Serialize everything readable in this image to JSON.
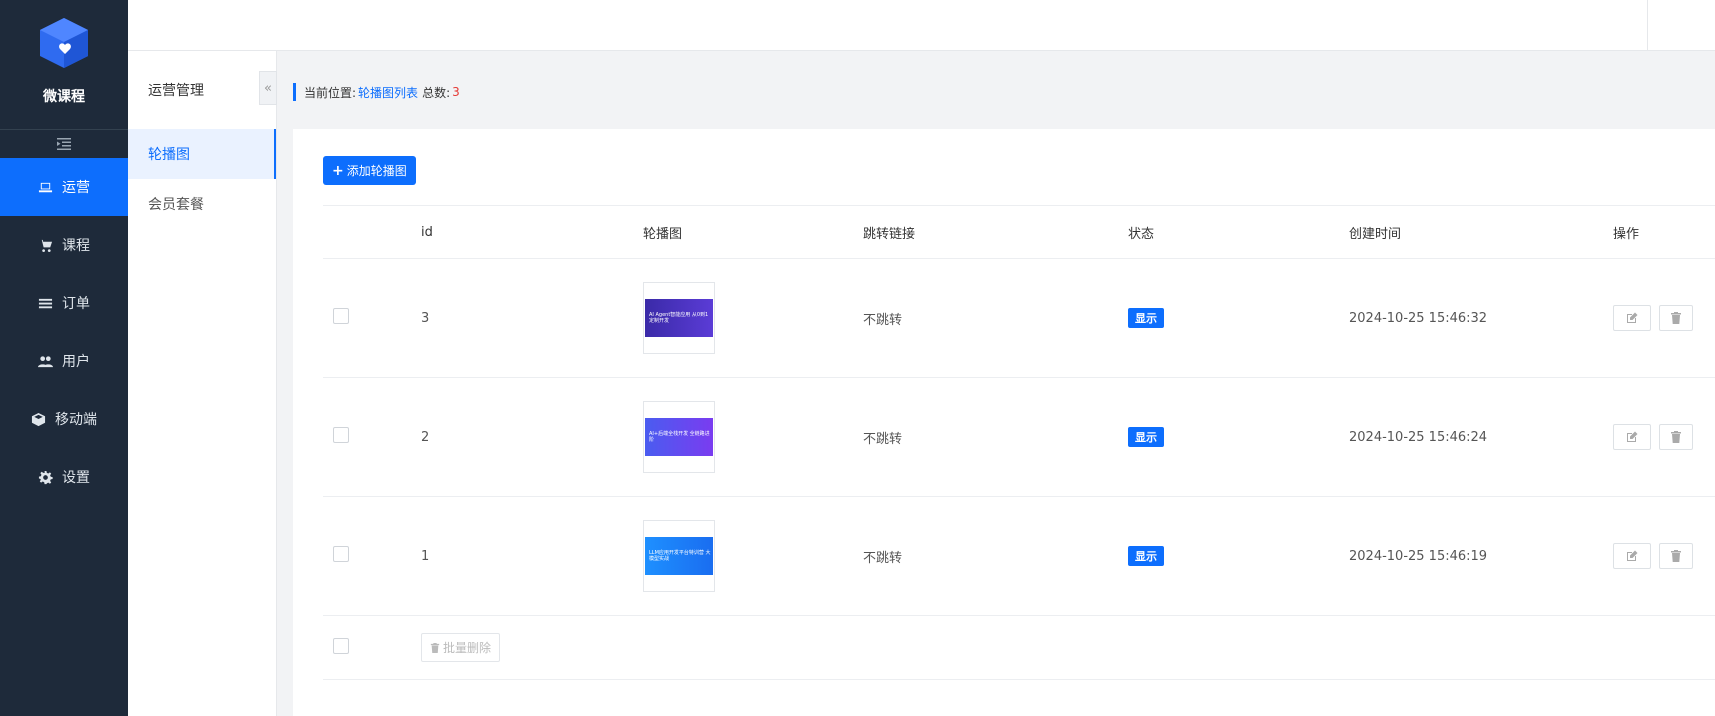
{
  "app": {
    "brand": "微课程"
  },
  "sidebar": {
    "items": [
      {
        "label": "运营",
        "icon": "laptop-icon",
        "active": true
      },
      {
        "label": "课程",
        "icon": "cart-icon",
        "active": false
      },
      {
        "label": "订单",
        "icon": "list-icon",
        "active": false
      },
      {
        "label": "用户",
        "icon": "users-icon",
        "active": false
      },
      {
        "label": "移动端",
        "icon": "cube-icon",
        "active": false
      },
      {
        "label": "设置",
        "icon": "gear-icon",
        "active": false
      }
    ]
  },
  "subnav": {
    "title": "运营管理",
    "items": [
      {
        "label": "轮播图",
        "active": true
      },
      {
        "label": "会员套餐",
        "active": false
      }
    ]
  },
  "breadcrumb": {
    "prefix": "当前位置:",
    "current": "轮播图列表",
    "total_label": "总数:",
    "total": "3"
  },
  "toolbar": {
    "add_label": "添加轮播图"
  },
  "table": {
    "headers": [
      "id",
      "轮播图",
      "跳转链接",
      "状态",
      "创建时间",
      "操作"
    ],
    "rows": [
      {
        "id": "3",
        "banner_text": "AI Agent智能应用 从0到1定制开发",
        "link": "不跳转",
        "status": "显示",
        "created": "2024-10-25 15:46:32"
      },
      {
        "id": "2",
        "banner_text": "AI+后端全栈开发 全链路进阶",
        "link": "不跳转",
        "status": "显示",
        "created": "2024-10-25 15:46:24"
      },
      {
        "id": "1",
        "banner_text": "LLM应用开发平台特训营 大模型实战",
        "link": "不跳转",
        "status": "显示",
        "created": "2024-10-25 15:46:19"
      }
    ],
    "bulk_delete_label": "批量删除"
  },
  "colors": {
    "primary": "#0d6efd",
    "sidebar_bg": "#1e2a3a",
    "count_red": "#e53935"
  }
}
